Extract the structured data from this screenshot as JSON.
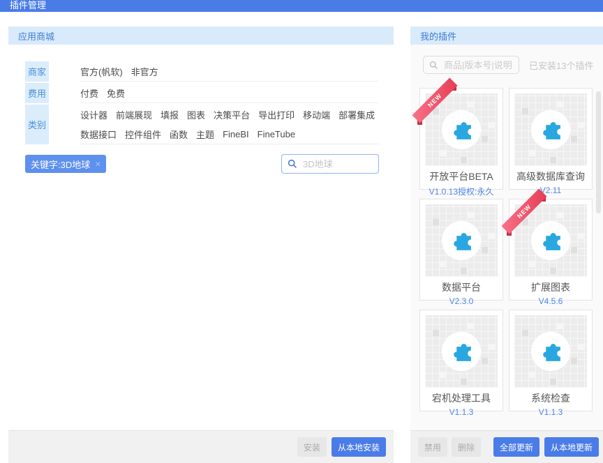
{
  "titlebar": {
    "title": "插件管理"
  },
  "store": {
    "header": "应用商城",
    "filters": [
      {
        "label": "商家",
        "lines": [
          [
            "官方(帆软)",
            "非官方"
          ]
        ]
      },
      {
        "label": "费用",
        "lines": [
          [
            "付费",
            "免费"
          ]
        ]
      },
      {
        "label": "类别",
        "lines": [
          [
            "设计器",
            "前端展现",
            "填报",
            "图表",
            "决策平台",
            "导出打印",
            "移动端",
            "部署集成"
          ],
          [
            "数据接口",
            "控件组件",
            "函数",
            "主题",
            "FineBI",
            "FineTube"
          ]
        ]
      }
    ],
    "keyword_tag": {
      "label": "关键字:3D地球",
      "close": "×"
    },
    "search_placeholder": "3D地球",
    "install_button": "安装",
    "install_local_button": "从本地安装"
  },
  "my_plugins": {
    "header": "我的插件",
    "search_placeholder": "商品|版本号|说明",
    "installed_count": "已安装13个插件",
    "ribbon_label": "NEW",
    "cards": [
      {
        "name": "开放平台BETA",
        "version": "V1.0.13授权:永久",
        "is_new": true
      },
      {
        "name": "高级数据库查询",
        "version": "V2.11",
        "is_new": false
      },
      {
        "name": "数据平台",
        "version": "V2.3.0",
        "is_new": false
      },
      {
        "name": "扩展图表",
        "version": "V4.5.6",
        "is_new": true
      },
      {
        "name": "宕机处理工具",
        "version": "V1.1.3",
        "is_new": false
      },
      {
        "name": "系统检查",
        "version": "V1.1.3",
        "is_new": false
      }
    ],
    "disable_button": "禁用",
    "delete_button": "删除",
    "update_all_button": "全部更新",
    "update_local_button": "从本地更新"
  },
  "colors": {
    "titlebar_blue": "#4A7CE8",
    "panel_header_bg": "#D9EAFA",
    "panel_header_text": "#3D7DD6",
    "accent_button_blue": "#4A7CE8",
    "keyword_tag_blue": "#5E90EE",
    "version_text_blue": "#4E86E8",
    "puzzle_icon_blue": "#29A7E1",
    "ribbon_red": "#E63E55"
  }
}
